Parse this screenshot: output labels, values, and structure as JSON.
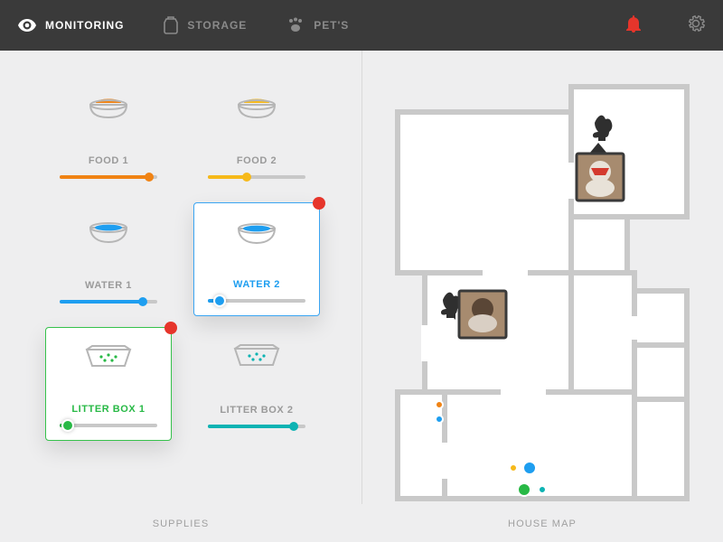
{
  "nav": {
    "monitoring": "MONITORING",
    "storage": "STORAGE",
    "pets": "PET'S"
  },
  "supplies": {
    "section_label": "SUPPLIES",
    "items": [
      {
        "label": "FOOD 1",
        "level": 0.92,
        "color": "orange",
        "selected": false,
        "alert": false,
        "icon": "food"
      },
      {
        "label": "FOOD 2",
        "level": 0.4,
        "color": "yellow",
        "selected": false,
        "alert": false,
        "icon": "food"
      },
      {
        "label": "WATER 1",
        "level": 0.85,
        "color": "blue",
        "selected": false,
        "alert": false,
        "icon": "water"
      },
      {
        "label": "WATER 2",
        "level": 0.12,
        "color": "blue",
        "selected": true,
        "alert": true,
        "icon": "water"
      },
      {
        "label": "LITTER BOX 1",
        "level": 0.08,
        "color": "green",
        "selected": true,
        "alert": true,
        "icon": "litter"
      },
      {
        "label": "LITTER BOX 2",
        "level": 0.88,
        "color": "teal",
        "selected": false,
        "alert": false,
        "icon": "litter"
      }
    ]
  },
  "house_map": {
    "section_label": "HOUSE MAP"
  },
  "colors": {
    "orange": "#f08314",
    "yellow": "#f6b91a",
    "blue": "#1e9ef0",
    "green": "#28b946",
    "teal": "#0db3b3",
    "alert": "#e6352b"
  }
}
